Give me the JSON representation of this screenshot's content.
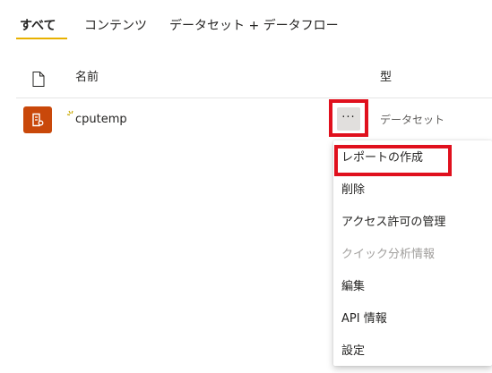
{
  "tabs": [
    {
      "label": "すべて",
      "active": true
    },
    {
      "label": "コンテンツ",
      "active": false
    },
    {
      "label": "データセット + データフロー",
      "active": false
    }
  ],
  "table": {
    "columns": {
      "icon": "file-icon",
      "name": "名前",
      "type": "型"
    },
    "rows": [
      {
        "icon": "dataset-icon",
        "name": "cputemp",
        "more_label": "···",
        "type": "データセット"
      }
    ]
  },
  "context_menu": {
    "items": [
      {
        "label": "レポートの作成",
        "enabled": true,
        "highlighted": true
      },
      {
        "label": "削除",
        "enabled": true
      },
      {
        "label": "アクセス許可の管理",
        "enabled": true
      },
      {
        "label": "クイック分析情報",
        "enabled": false
      },
      {
        "label": "編集",
        "enabled": true
      },
      {
        "label": "API 情報",
        "enabled": true
      },
      {
        "label": "設定",
        "enabled": true
      }
    ]
  },
  "colors": {
    "accent_underline": "#e8b100",
    "dataset_icon_bg": "#c9480a",
    "highlight_box": "#e0101d",
    "disabled_text": "#a19f9d"
  }
}
